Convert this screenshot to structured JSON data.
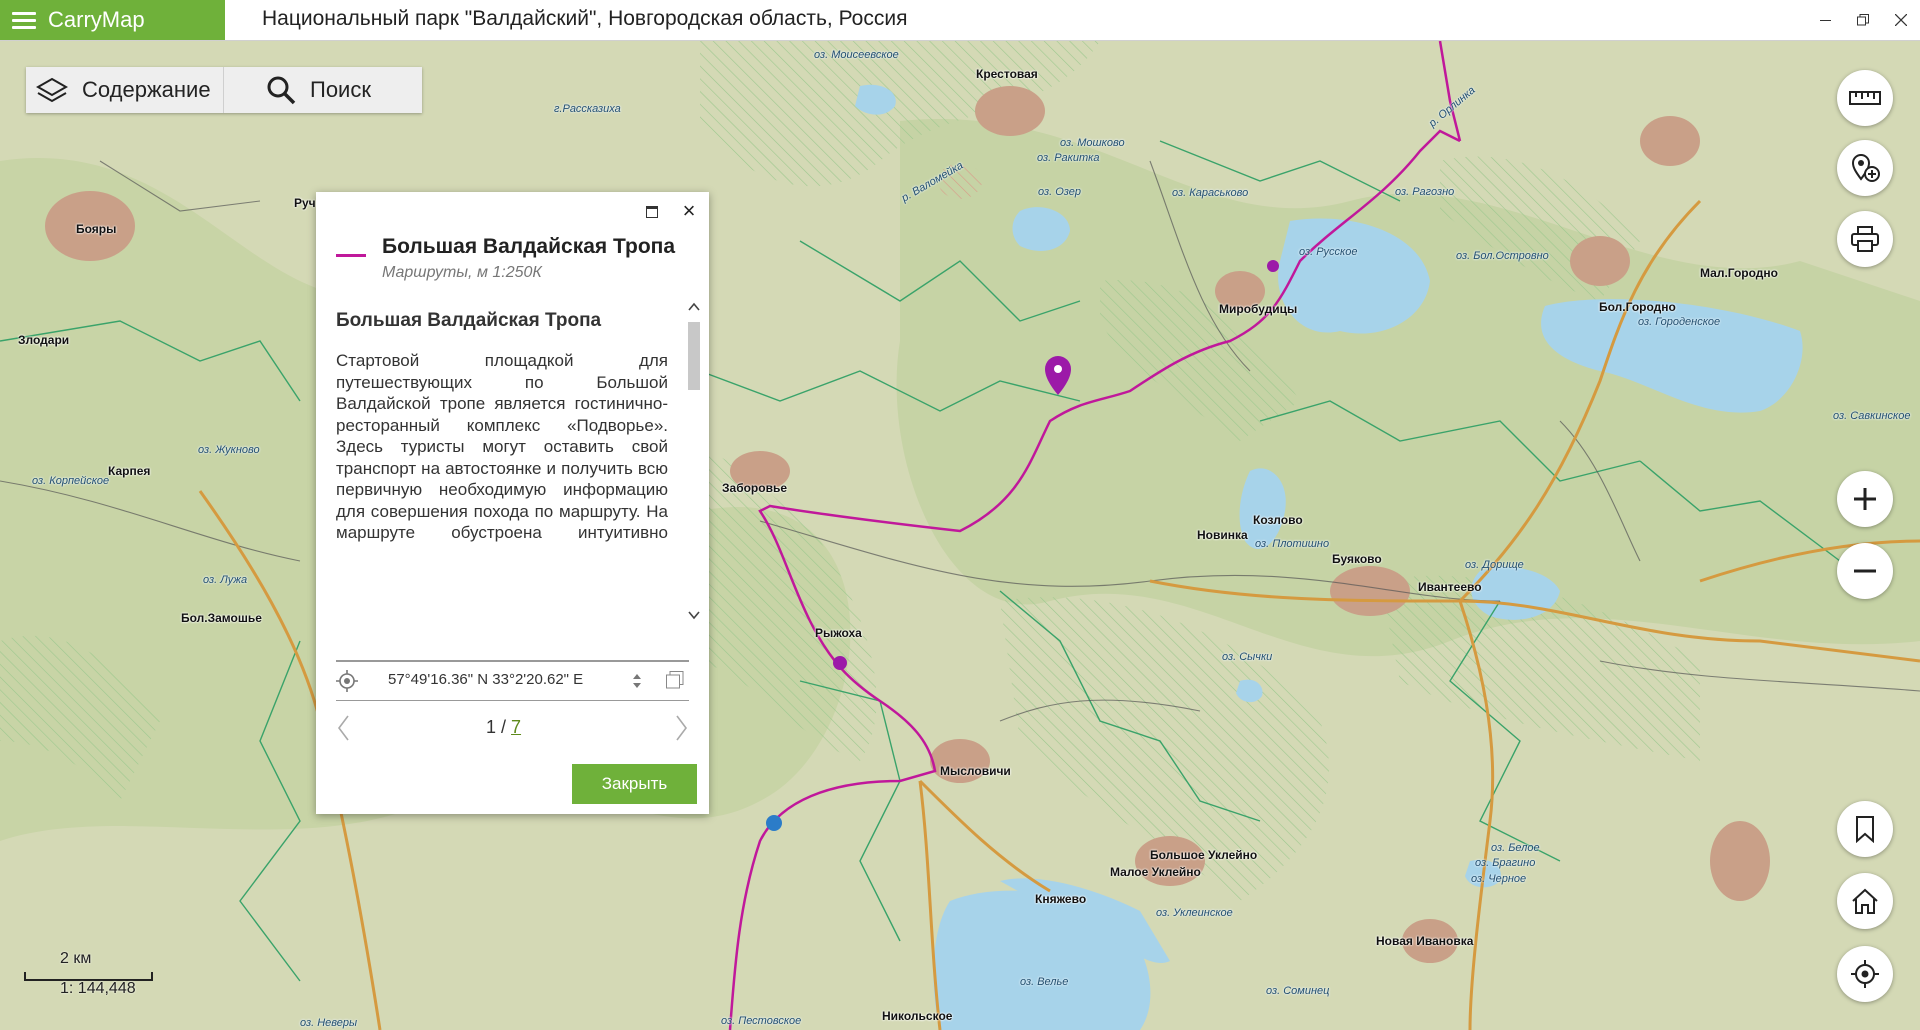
{
  "app": {
    "name": "CarryMap",
    "window_title": "Национальный парк \"Валдайский\", Новгородская область, Россия",
    "brand_color": "#6fb13a",
    "route_color": "#c0189b"
  },
  "toolbar": {
    "toc_label": "Содержание",
    "search_label": "Поиск"
  },
  "popup": {
    "title": "Большая Валдайская Тропа",
    "subtitle": "Маршруты, м 1:250К",
    "content_heading": "Большая Валдайская Тропа",
    "content_text": "Стартовой площадкой для путешествующих по Большой Валдайской тропе является гостинично-ресторанный комплекс «Подворье». Здесь туристы могут оставить свой транспорт на автостоянке и получить всю первичную необходимую информацию для совершения похода по маршруту. На маршруте обустроена интуитивно понятная система навигации: указатели, маркировочные столбики. Базовые лагеря оборудованы всем",
    "coordinates": "57°49'16.36\" N 33°2'20.62\" E",
    "page_current": "1",
    "page_separator": " / ",
    "page_total": "7",
    "close_label": "Закрыть"
  },
  "map_labels": {
    "settlements": [
      "Крестовая",
      "Бояры",
      "Руч",
      "Злодари",
      "Карпея",
      "Бол.Замошье",
      "Заборовье",
      "Рыжоха",
      "Мысловичи",
      "Миробудицы",
      "Новинка",
      "Козлово",
      "Буяково",
      "Ивантеево",
      "Бол.Городно",
      "Мал.Городно",
      "Большое Уклейно",
      "Малое Уклейно",
      "Княжево",
      "Новая Ивановка",
      "Никольское"
    ],
    "water": [
      "оз. Моисеевское",
      "г.Рассказиха",
      "оз. Ракитка",
      "оз. Мошково",
      "оз. Озер",
      "оз. Караськово",
      "оз. Рагозно",
      "оз. Русское",
      "оз. Бол.Островно",
      "оз. Городенское",
      "оз. Савкинское",
      "оз. Жукново",
      "оз. Корпейское",
      "оз. Лужа",
      "оз. Плотишно",
      "оз. Дорище",
      "оз. Сычки",
      "оз. Белое",
      "оз. Брагино",
      "оз. Черное",
      "оз. Уклеинское",
      "оз. Велье",
      "оз. Соминец",
      "оз. Неверы",
      "оз. Пестовское",
      "р. Валомейка",
      "р. Орлинка"
    ]
  },
  "scale": {
    "distance": "2 км",
    "ratio": "1: 144,448"
  }
}
